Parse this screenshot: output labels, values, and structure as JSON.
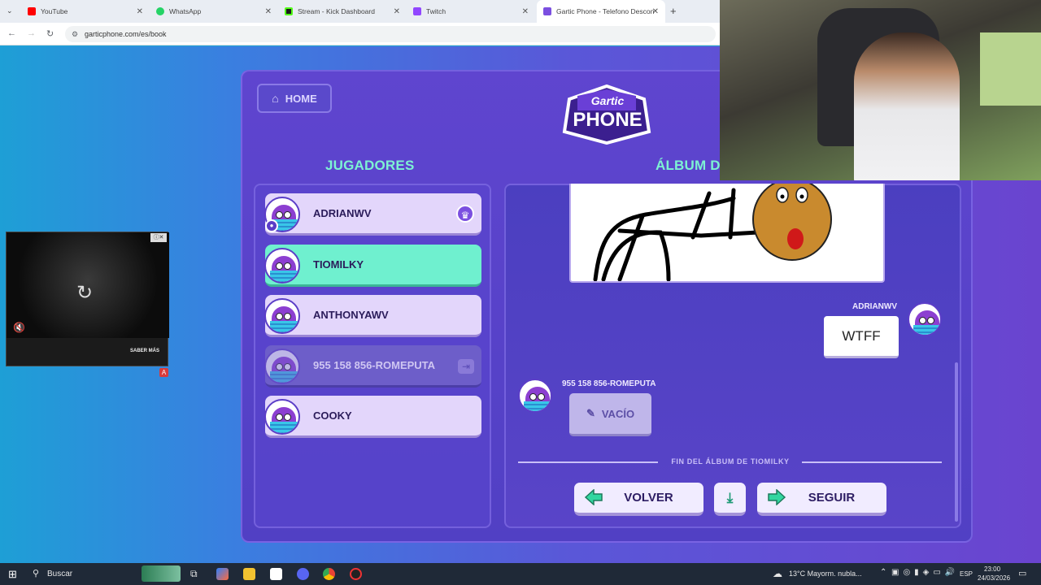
{
  "browser": {
    "tabs": [
      {
        "label": "YouTube",
        "color": "#ff0000"
      },
      {
        "label": "WhatsApp",
        "color": "#25d366"
      },
      {
        "label": "Stream - Kick Dashboard",
        "color": "#53fc18"
      },
      {
        "label": "Twitch",
        "color": "#9146ff"
      },
      {
        "label": "Gartic Phone - Telefono Descon",
        "color": "#7b4fe0"
      }
    ],
    "new_tab_icon": "+",
    "url": "garticphone.com/es/book"
  },
  "app": {
    "home_label": "HOME",
    "logo_top": "Gartic",
    "logo_bottom": "PHONE",
    "players_title": "JUGADORES",
    "album_title": "ÁLBUM D",
    "players": [
      {
        "name": "ADRIANWV",
        "host": true,
        "status": "normal"
      },
      {
        "name": "TIOMILKY",
        "host": false,
        "status": "current"
      },
      {
        "name": "ANTHONYAWV",
        "host": false,
        "status": "normal"
      },
      {
        "name": "955 158 856-ROMEPUTA",
        "host": false,
        "status": "disconnected"
      },
      {
        "name": "COOKY",
        "host": false,
        "status": "normal"
      }
    ],
    "album": {
      "reply_author": "ADRIANWV",
      "reply_text": "WTFF",
      "empty_author": "955 158 856-ROMEPUTA",
      "empty_label": "VACÍO",
      "end_text": "FIN DEL ÁLBUM DE TIOMILKY"
    },
    "back_label": "VOLVER",
    "next_label": "SEGUIR"
  },
  "ad": {
    "more_label": "SABER MÁS",
    "badge": "A"
  },
  "taskbar": {
    "search_placeholder": "Buscar",
    "weather": "13°C  Mayorm. nubla...",
    "lang": "ESP",
    "time": "23:00",
    "date": "24/03/2026"
  }
}
